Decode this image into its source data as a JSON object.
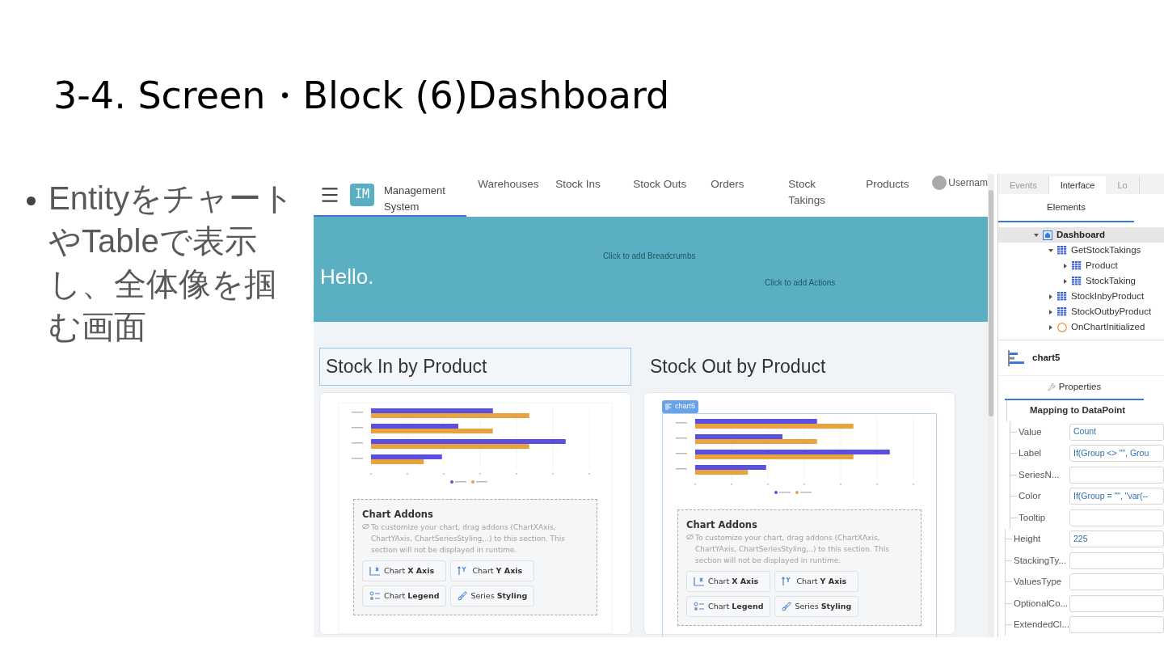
{
  "slide": {
    "title": "3-4. Screen・Block (6)Dashboard",
    "bullets": [
      "EntityをチャートやTableで表示し、全体像を掴む画面"
    ]
  },
  "app": {
    "logo": "IM",
    "app_name": "Management System",
    "nav": [
      "Warehouses",
      "Stock Ins",
      "Stock Outs",
      "Orders",
      "Stock Takings",
      "Products"
    ],
    "user": "Usernam",
    "hero": {
      "greeting": "Hello.",
      "breadcrumbs_hint": "Click to add Breadcrumbs",
      "actions_hint": "Click to add Actions"
    },
    "panels": [
      {
        "title": "Stock In by Product",
        "title_outlined": true,
        "selected": false,
        "addons": {
          "title": "Chart Addons",
          "hint": "To customize your chart, drag addons (ChartXAxis, ChartYAxis, ChartSeriesStyling,..) to this section. This section will not be displayed in runtime.",
          "buttons": [
            {
              "kind": "x-axis",
              "label": "Chart **X Axis**"
            },
            {
              "kind": "y-axis",
              "label": "Chart **Y Axis**"
            },
            {
              "kind": "legend",
              "label": "Chart **Legend**"
            },
            {
              "kind": "styling",
              "label": "Series **Styling**"
            }
          ]
        }
      },
      {
        "title": "Stock Out by Product",
        "title_outlined": false,
        "selected": true,
        "badge": "chart5",
        "addons": {
          "title": "Chart Addons",
          "hint": "To customize your chart, drag addons (ChartXAxis, ChartYAxis, ChartSeriesStyling,..) to this section. This section will not be displayed in runtime.",
          "buttons": [
            {
              "kind": "x-axis",
              "label": "Chart **X Axis**"
            },
            {
              "kind": "y-axis",
              "label": "Chart **Y Axis**"
            },
            {
              "kind": "legend",
              "label": "Chart **Legend**"
            },
            {
              "kind": "styling",
              "label": "Series **Styling**"
            }
          ]
        }
      }
    ]
  },
  "inspector": {
    "tabs": [
      {
        "label": "Events",
        "selected": false
      },
      {
        "label": "Interface",
        "selected": true
      },
      {
        "label": "Lo",
        "selected": false
      }
    ],
    "subtab": "Elements",
    "tree": [
      {
        "label": "Dashboard",
        "kind": "screen",
        "expanded": true,
        "selected": true,
        "children": [
          {
            "label": "GetStockTakings",
            "kind": "aggregate",
            "expanded": true,
            "selected": false,
            "children": [
              {
                "label": "Product",
                "kind": "aggregate",
                "expanded": false,
                "selected": false
              },
              {
                "label": "StockTaking",
                "kind": "aggregate",
                "expanded": false,
                "selected": false
              }
            ]
          },
          {
            "label": "StockInbyProduct",
            "kind": "aggregate",
            "expanded": false,
            "selected": false
          },
          {
            "label": "StockOutbyProduct",
            "kind": "aggregate",
            "expanded": false,
            "selected": false
          },
          {
            "label": "OnChartInitialized",
            "kind": "action",
            "expanded": false,
            "selected": false
          }
        ]
      }
    ],
    "element": "chart5",
    "properties_tab": "Properties",
    "section": "Mapping to DataPoint",
    "mapping": [
      {
        "label": "Value",
        "value": "Count"
      },
      {
        "label": "Label",
        "value": "If(Group <> \"\", Grou"
      },
      {
        "label": "SeriesN..."
      },
      {
        "label": "Color",
        "value": "If(Group = \"\", \"var(--"
      },
      {
        "label": "Tooltip"
      }
    ],
    "properties": [
      {
        "label": "Height",
        "value": "225"
      },
      {
        "label": "StackingTy..."
      },
      {
        "label": "ValuesType"
      },
      {
        "label": "OptionalCo..."
      },
      {
        "label": "ExtendedCl..."
      }
    ]
  }
}
